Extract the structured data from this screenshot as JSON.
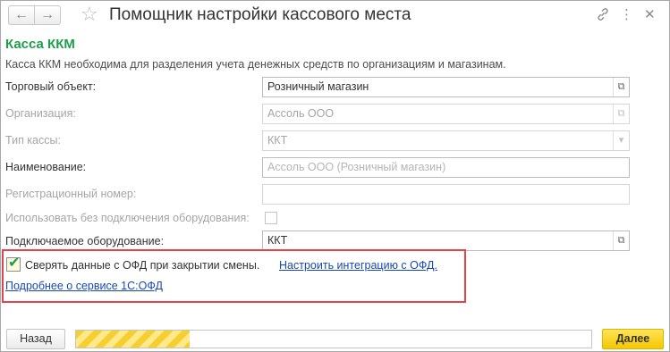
{
  "window": {
    "title": "Помощник настройки кассового места",
    "nav_back_icon": "←",
    "nav_forward_icon": "→",
    "favorite_icon": "☆",
    "link_icon": "🔗",
    "more_icon": "⋮",
    "close_icon": "✕"
  },
  "section": {
    "title": "Касса ККМ",
    "description": "Касса ККМ необходима для разделения учета денежных средств по организациям и магазинам."
  },
  "form": {
    "trade_object": {
      "label": "Торговый объект:",
      "value": "Розничный магазин"
    },
    "organization": {
      "label": "Организация:",
      "value": "Ассоль ООО"
    },
    "register_type": {
      "label": "Тип кассы:",
      "value": "ККТ"
    },
    "name": {
      "label": "Наименование:",
      "placeholder": "Ассоль ООО (Розничный магазин)"
    },
    "reg_number": {
      "label": "Регистрационный номер:",
      "value": ""
    },
    "no_equipment": {
      "label": "Использовать без подключения оборудования:",
      "checked": false
    },
    "equipment": {
      "label": "Подключаемое оборудование:",
      "value": "ККТ"
    }
  },
  "ofd": {
    "check_label": "Сверять данные с ОФД при закрытии смены.",
    "checked": true,
    "setup_link": "Настроить интеграцию с ОФД.",
    "service_link": "Подробнее о сервисе 1С:ОФД"
  },
  "footer": {
    "back_label": "Назад",
    "next_label": "Далее",
    "progress_fraction": 0.22
  },
  "colors": {
    "accent_green": "#1e9e4a",
    "highlight_red": "#e2434c",
    "link_blue": "#1848b4",
    "button_yellow": "#f5c800"
  }
}
